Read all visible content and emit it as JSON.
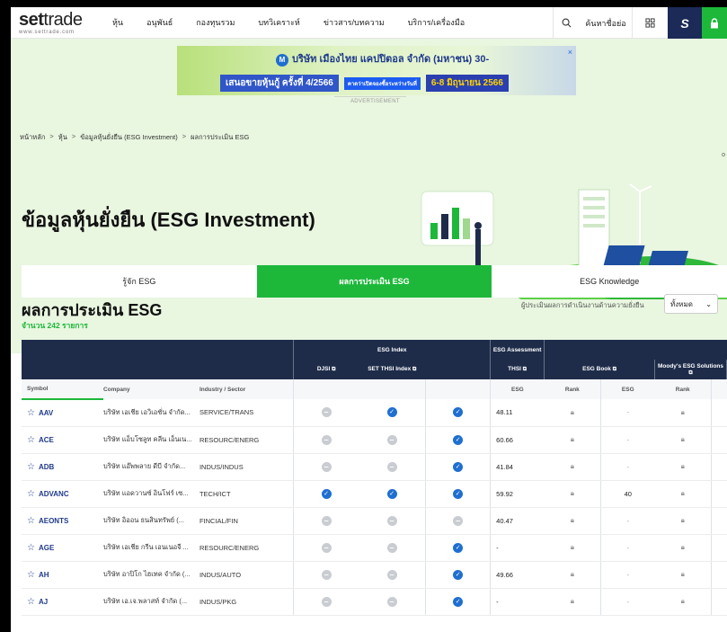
{
  "logo": {
    "main_a": "set",
    "main_b": "trade",
    "sub": "www.settrade.com"
  },
  "nav": {
    "items": [
      "หุ้น",
      "อนุพันธ์",
      "กองทุนรวม",
      "บทวิเคราะห์",
      "ข่าวสาร/บทความ",
      "บริการ/เครื่องมือ"
    ],
    "search_placeholder": "ค้นหาชื่อย่อ",
    "search_icon": "search-icon",
    "grid_icon": "grid-icon",
    "s_label": "S",
    "lock_icon": "lock-icon"
  },
  "ad": {
    "line1": "บริษัท เมืองไทย แคปปิตอล จำกัด (มหาชน) 30-",
    "chip1": "เสนอขายหุ้นกู้ ครั้งที่ 4/2566",
    "chip2": "คาดว่าเปิดจองซื้อระหว่างวันที่",
    "chip3": "6-8 มิถุนายน 2566",
    "close": "×",
    "label": "ADVERTISEMENT"
  },
  "breadcrumb": {
    "items": [
      "หน้าหลัก",
      "หุ้น",
      "ข้อมูลหุ้นยั่งยืน (ESG Investment)",
      "ผลการประเมิน ESG"
    ],
    "sep": ">"
  },
  "page_title": "ข้อมูลหุ้นยั่งยืน (ESG Investment)",
  "tabs": [
    {
      "label": "รู้จัก ESG",
      "active": false
    },
    {
      "label": "ผลการประเมิน ESG",
      "active": true
    },
    {
      "label": "ESG Knowledge",
      "active": false
    }
  ],
  "section": {
    "title": "ผลการประเมิน ESG",
    "count": "จำนวน 242 รายการ",
    "filter_label": "ผู้ประเมินผลการดำเนินงานด้านความยั่งยืน",
    "filter_value": "ทั้งหมด"
  },
  "table": {
    "group_headers": {
      "esg_index": "ESG Index",
      "esg_assessment": "ESG Assessment"
    },
    "sub_headers": {
      "djsi": "DJSI",
      "set_thsi": "SET THSI Index",
      "thsi": "THSI",
      "esg_book": "ESG Book",
      "moodys": "Moody's ESG Solutions"
    },
    "columns": {
      "symbol": "Symbol",
      "company": "Company",
      "industry": "Industry / Sector",
      "esg": "ESG",
      "rank": "Rank"
    },
    "rows": [
      {
        "symbol": "AAV",
        "company": "บริษัท เอเชีย เอวิเอชั่น จำกัด...",
        "industry": "SERVICE/TRANS",
        "djsi": "no",
        "set_thsi": "yes",
        "thsi": "yes",
        "esgbook": "48.11",
        "moodys": "-"
      },
      {
        "symbol": "ACE",
        "company": "บริษัท แอ็บโซลูท คลีน เอ็นเน...",
        "industry": "RESOURC/ENERG",
        "djsi": "no",
        "set_thsi": "no",
        "thsi": "yes",
        "esgbook": "60.66",
        "moodys": "-"
      },
      {
        "symbol": "ADB",
        "company": "บริษัท แอ๊พพลาย ดีบี จำกัด...",
        "industry": "INDUS/INDUS",
        "djsi": "no",
        "set_thsi": "no",
        "thsi": "yes",
        "esgbook": "41.84",
        "moodys": "-"
      },
      {
        "symbol": "ADVANC",
        "company": "บริษัท แอดวานซ์ อินโฟร์ เซ...",
        "industry": "TECH/ICT",
        "djsi": "yes",
        "set_thsi": "yes",
        "thsi": "yes",
        "esgbook": "59.92",
        "moodys": "40"
      },
      {
        "symbol": "AEONTS",
        "company": "บริษัท อิออน ธนสินทรัพย์ (...",
        "industry": "FINCIAL/FIN",
        "djsi": "no",
        "set_thsi": "no",
        "thsi": "no",
        "esgbook": "40.47",
        "moodys": "-"
      },
      {
        "symbol": "AGE",
        "company": "บริษัท เอเชีย กรีน เอนเนอจี ...",
        "industry": "RESOURC/ENERG",
        "djsi": "no",
        "set_thsi": "no",
        "thsi": "yes",
        "esgbook": "-",
        "moodys": "-"
      },
      {
        "symbol": "AH",
        "company": "บริษัท อาปิโก ไฮเทค จำกัด (...",
        "industry": "INDUS/AUTO",
        "djsi": "no",
        "set_thsi": "no",
        "thsi": "yes",
        "esgbook": "49.66",
        "moodys": "-"
      },
      {
        "symbol": "AJ",
        "company": "บริษัท เอ.เจ.พลาสท์ จำกัด (...",
        "industry": "INDUS/PKG",
        "djsi": "no",
        "set_thsi": "no",
        "thsi": "yes",
        "esgbook": "-",
        "moodys": "-"
      }
    ]
  },
  "colors": {
    "brand_green": "#1db83a",
    "navy": "#1e2c4a",
    "link_blue": "#1f6fd0",
    "hero_bg": "#e9f6e0"
  }
}
